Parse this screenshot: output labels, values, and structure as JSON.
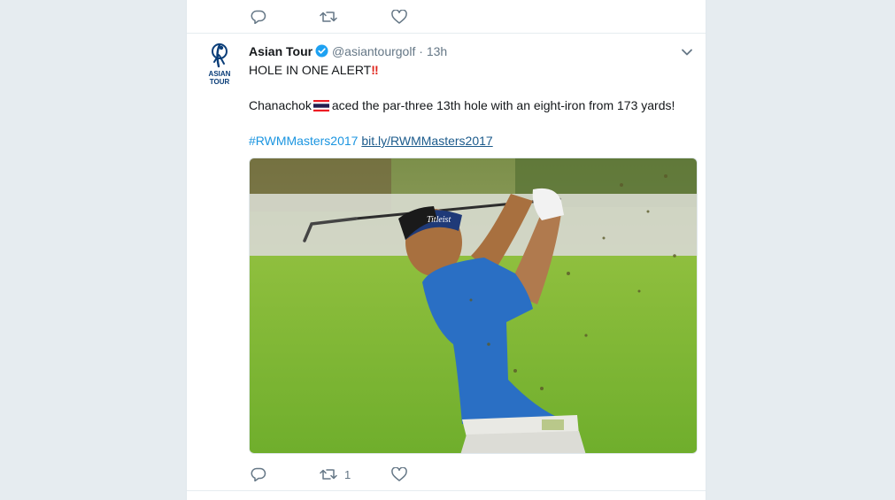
{
  "prev_tweet": {
    "reply_count": "",
    "retweet_count": "",
    "like_count": ""
  },
  "tweet": {
    "author_name": "Asian Tour",
    "handle": "@asiantourgolf",
    "separator": "·",
    "time": "13h",
    "avatar_logo_text": [
      "ASIAN",
      "TOUR"
    ],
    "line1": "HOLE IN ONE ALERT",
    "line1_emoji": "‼",
    "line2_before": "Chanachok",
    "line2_after": "aced the par-three 13th hole with an eight-iron from 173 yards!",
    "hashtag": "#RWMMasters2017",
    "url": "bit.ly/RWMMasters2017",
    "image_caption_text": "Titleist",
    "reply_count": "",
    "retweet_count": "1",
    "like_count": ""
  },
  "colors": {
    "background": "#e6ecf0",
    "card": "#ffffff",
    "link": "#1b95e0",
    "muted": "#657786",
    "verified": "#1da1f2",
    "shirt": "#2a6fc4"
  },
  "icons": [
    "reply-icon",
    "retweet-icon",
    "like-icon",
    "verified-badge-icon",
    "chevron-down-icon",
    "thailand-flag-icon"
  ]
}
